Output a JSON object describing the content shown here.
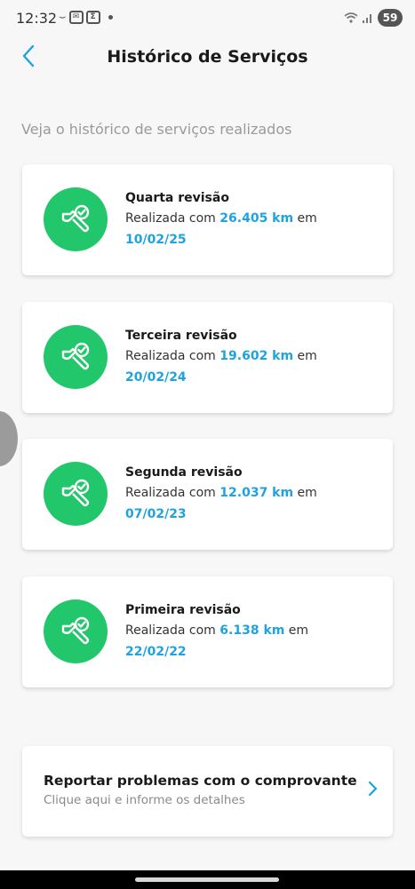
{
  "status_bar": {
    "time": "12:32",
    "left_icons": [
      "sms-icon",
      "mail-icon",
      "sigma-app-icon",
      "dot-icon"
    ],
    "right_icons": [
      "wifi-icon",
      "signal-icon"
    ],
    "battery": "59"
  },
  "header": {
    "title": "Histórico de Serviços",
    "back_icon": "chevron-left-icon"
  },
  "subtitle": "Veja o histórico de serviços realizados",
  "services": [
    {
      "title": "Quarta revisão",
      "prefix": "Realizada com",
      "km": "26.405 km",
      "suffix": "em",
      "date": "10/02/25"
    },
    {
      "title": "Terceira revisão",
      "prefix": "Realizada com",
      "km": "19.602 km",
      "suffix": "em",
      "date": "20/02/24"
    },
    {
      "title": "Segunda revisão",
      "prefix": "Realizada com",
      "km": "12.037 km",
      "suffix": "em",
      "date": "07/02/23"
    },
    {
      "title": "Primeira revisão",
      "prefix": "Realizada com",
      "km": "6.138 km",
      "suffix": "em",
      "date": "22/02/22"
    }
  ],
  "service_icon": "wrench-check-icon",
  "report": {
    "title": "Reportar problemas com o comprovante",
    "subtitle": "Clique aqui e informe os detalhes",
    "icon": "chevron-right-icon"
  },
  "colors": {
    "accent_blue": "#1ea3df",
    "icon_green": "#22c76b",
    "background": "#f7f7f7"
  }
}
